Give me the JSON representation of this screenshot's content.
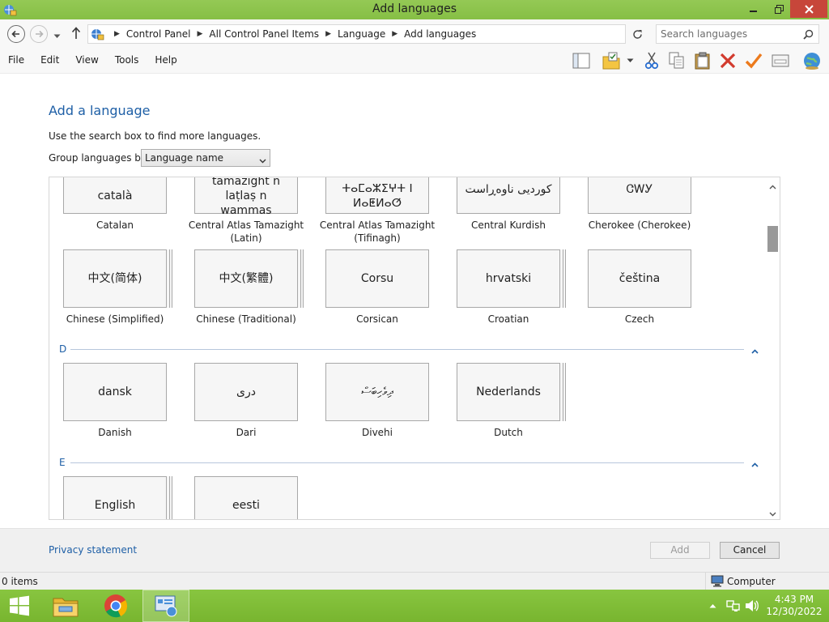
{
  "window": {
    "title": "Add languages"
  },
  "address": {
    "crumbs": [
      "Control Panel",
      "All Control Panel Items",
      "Language",
      "Add languages"
    ]
  },
  "search": {
    "placeholder": "Search languages"
  },
  "menu": [
    "File",
    "Edit",
    "View",
    "Tools",
    "Help"
  ],
  "toolbar_icons": [
    "layout-icon",
    "folder-check-icon",
    "scissors-icon",
    "copy-icon",
    "paste-icon",
    "delete-icon",
    "check-icon",
    "properties-icon",
    "globe-icon"
  ],
  "page": {
    "heading": "Add a language",
    "hint": "Use the search box to find more languages.",
    "group_label": "Group languages by:",
    "group_value": "Language name"
  },
  "languages": [
    {
      "native": "català",
      "name": "Catalan"
    },
    {
      "native": "tamazight n laṭlaṣ n wammas",
      "name": "Central Atlas Tamazight (Latin)"
    },
    {
      "native": "ⵜⴰⵎⴰⵣⵉⵖⵜ ⵏ ⵍⴰⵟⵍⴰⵚ",
      "name": "Central Atlas Tamazight (Tifinagh)"
    },
    {
      "native": "کوردیی ناوەڕاست",
      "name": "Central Kurdish"
    },
    {
      "native": "ᏣᎳᎩ",
      "name": "Cherokee (Cherokee)"
    },
    {
      "native": "中文(简体)",
      "name": "Chinese (Simplified)"
    },
    {
      "native": "中文(繁體)",
      "name": "Chinese (Traditional)"
    },
    {
      "native": "Corsu",
      "name": "Corsican"
    },
    {
      "native": "hrvatski",
      "name": "Croatian"
    },
    {
      "native": "čeština",
      "name": "Czech"
    },
    {
      "native": "dansk",
      "name": "Danish"
    },
    {
      "native": "درى",
      "name": "Dari"
    },
    {
      "native": "ދިވެހިބަސް",
      "name": "Divehi"
    },
    {
      "native": "Nederlands",
      "name": "Dutch"
    },
    {
      "native": "English",
      "name": ""
    },
    {
      "native": "eesti",
      "name": ""
    }
  ],
  "groups": {
    "d": "D",
    "e": "E"
  },
  "footer": {
    "privacy": "Privacy statement",
    "add": "Add",
    "cancel": "Cancel"
  },
  "status": {
    "items": "0 items",
    "zone": "Computer"
  },
  "taskbar": {
    "time": "4:43 PM",
    "date": "12/30/2022"
  },
  "colors": {
    "accent": "#1e5fa6",
    "titlebar": "#8bc34a",
    "taskbar": "#7fbf37",
    "close": "#c7463a"
  }
}
